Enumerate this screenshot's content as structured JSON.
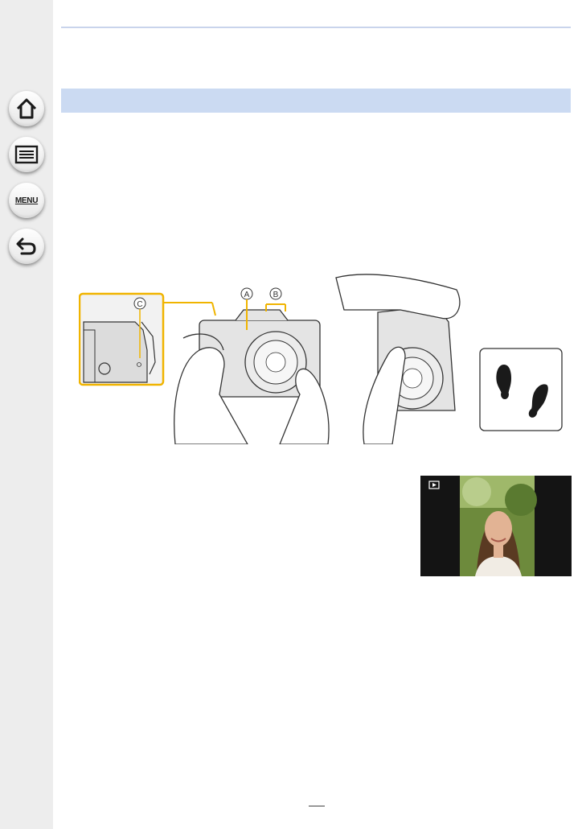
{
  "sidebar": {
    "items": [
      {
        "name": "home",
        "icon": "home-icon"
      },
      {
        "name": "contents",
        "icon": "list-icon"
      },
      {
        "name": "menu",
        "label": "MENU"
      },
      {
        "name": "back",
        "icon": "back-arrow-icon"
      }
    ]
  },
  "figure": {
    "labels": {
      "a": "A",
      "b": "B",
      "c": "C"
    },
    "highlight_color": "#f0b400"
  },
  "colors": {
    "section_bar": "#cbdaf2",
    "top_rule": "#c9d4ec",
    "sidebar": "#ededed"
  }
}
